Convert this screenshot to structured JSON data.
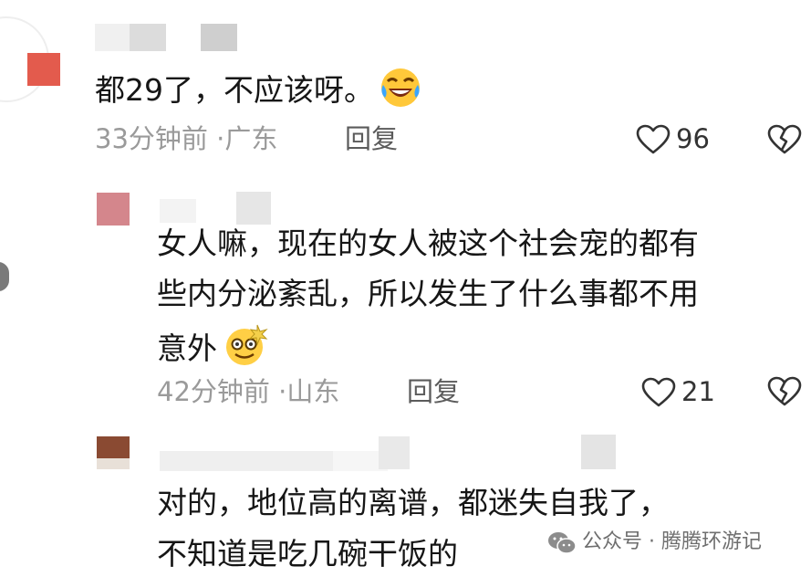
{
  "colors": {
    "text": "#161616",
    "meta": "#9a9a9a",
    "reply": "#5b5b5b",
    "avatar1": "#e35b4d",
    "avatar2": "#d4868c",
    "avatar3": "#8a4a32"
  },
  "comments": [
    {
      "content_lines": [
        "都29了，不应该呀。"
      ],
      "emoji": "face-with-tears-of-joy-icon",
      "time": "33分钟前",
      "location": "广东",
      "reply_label": "回复",
      "likes": "96"
    },
    {
      "content_lines": [
        "女人嘛，现在的女人被这个社会宠的都有",
        "些内分泌紊乱，所以发生了什么事都不用",
        "意外"
      ],
      "emoji": "dizzy-face-icon",
      "time": "42分钟前",
      "location": "山东",
      "reply_label": "回复",
      "likes": "21"
    },
    {
      "content_lines": [
        "对的，地位高的离谱，都迷失自我了，",
        "不知道是吃几碗干饭的"
      ]
    }
  ],
  "watermark": {
    "text": "公众号 · 腾腾环游记"
  }
}
